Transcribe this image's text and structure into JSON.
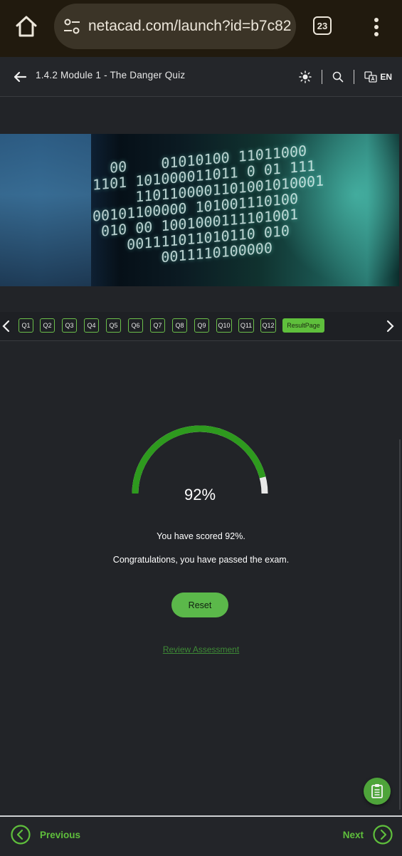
{
  "browser": {
    "url": "netacad.com/launch?id=b7c82",
    "tab_count": "23"
  },
  "header": {
    "title": "1.4.2 Module 1 - The Danger Quiz",
    "language": "EN"
  },
  "banner": {
    "digits": "  00    01010100 11011000\n1101 101000011011 0 01 111\n     1101100001101001010001\n00101100000 101001110100\n 010 00 1001000111101001\n    001111011010110 010\n        0011110100000"
  },
  "question_nav": {
    "items": [
      "Q1",
      "Q2",
      "Q3",
      "Q4",
      "Q5",
      "Q6",
      "Q7",
      "Q8",
      "Q9",
      "Q10",
      "Q11",
      "Q12"
    ],
    "result_label": "ResultPage"
  },
  "result": {
    "score_percent": 92,
    "score_display": "92%",
    "score_message": "You have scored 92%.",
    "pass_message": "Congratulations, you have passed the exam.",
    "reset_label": "Reset",
    "review_label": "Review Assessment",
    "gauge_color": "#2e9a1e",
    "gauge_remaining_color": "#e8e8e8"
  },
  "footer": {
    "previous_label": "Previous",
    "next_label": "Next",
    "accent_color": "#5fbf3c"
  }
}
